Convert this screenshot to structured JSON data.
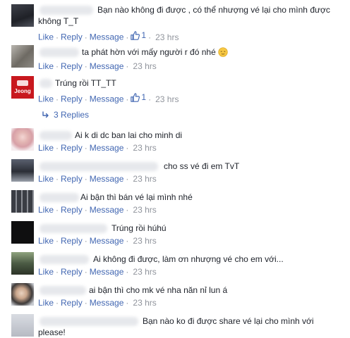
{
  "actions": {
    "like": "Like",
    "reply": "Reply",
    "message": "Message",
    "sep": "·"
  },
  "comments": [
    {
      "text": "Bạn nào không đi được , có thể nhượng vé lại cho mình được không T_T",
      "likes": "1",
      "time": "23 hrs"
    },
    {
      "text": "ta phát hờn với mấy người r đó nhé",
      "emoji": "relieved-face",
      "time": "23 hrs"
    },
    {
      "text": "Trúng rồi TT_TT",
      "likes": "1",
      "time": "23 hrs",
      "avatar_label": "Jeong"
    },
    {
      "text": "Ai k di dc ban lai cho minh di",
      "time": "23 hrs"
    },
    {
      "text": "cho ss vé đi em TvT",
      "time": "23 hrs"
    },
    {
      "text": "Ai bận thì bán vé lại mình nhé",
      "time": "23 hrs"
    },
    {
      "text": "Trúng rồi húhú",
      "time": "23 hrs"
    },
    {
      "text": "Ai không đi được, làm ơn nhượng vé cho em với...",
      "time": "23 hrs"
    },
    {
      "text": "ai bận thì cho mk vé nha năn nỉ lun á",
      "time": "23 hrs"
    },
    {
      "text": "Bạn nào ko đi được share vé lại cho mình với please!"
    }
  ],
  "replies_link": "3 Replies",
  "colors": {
    "link": "#4267b2",
    "meta": "#90949c",
    "text": "#1d2129"
  }
}
